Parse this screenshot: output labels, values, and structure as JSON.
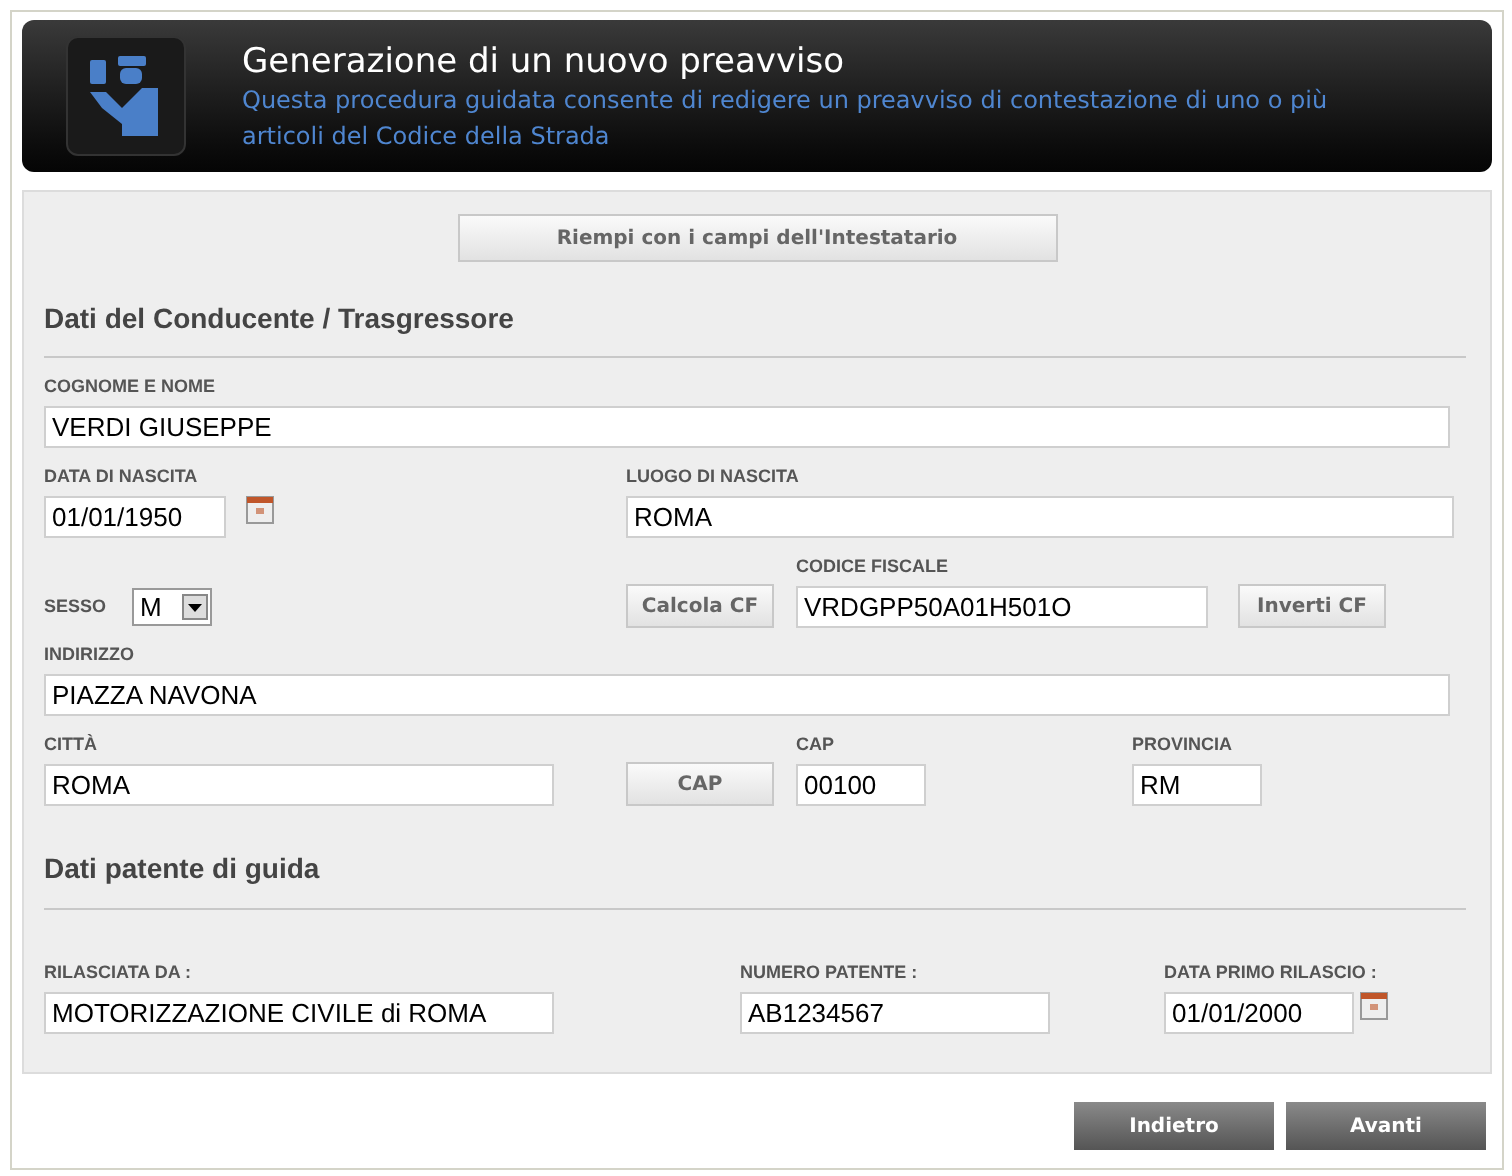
{
  "header": {
    "title": "Generazione di un nuovo preavviso",
    "description": "Questa procedura guidata consente di redigere un preavviso di contestazione di uno o più articoli del Codice della Strada"
  },
  "fill_button": "Riempi con i campi dell'Intestatario",
  "driver": {
    "heading": "Dati del Conducente / Trasgressore",
    "cognome_nome": {
      "label": "COGNOME E NOME",
      "value": "VERDI GIUSEPPE"
    },
    "data_nascita": {
      "label": "DATA DI NASCITA",
      "value": "01/01/1950"
    },
    "luogo_nascita": {
      "label": "LUOGO DI NASCITA",
      "value": "ROMA"
    },
    "sesso": {
      "label": "SESSO",
      "value": "M"
    },
    "calcola_button": "Calcola CF",
    "codice_fiscale": {
      "label": "CODICE FISCALE",
      "value": "VRDGPP50A01H501O"
    },
    "inverti_button": "Inverti CF",
    "indirizzo": {
      "label": "INDIRIZZO",
      "value": "PIAZZA NAVONA"
    },
    "citta": {
      "label": "CITTÀ",
      "value": "ROMA"
    },
    "cap_button": "CAP",
    "cap": {
      "label": "CAP",
      "value": "00100"
    },
    "provincia": {
      "label": "PROVINCIA",
      "value": "RM"
    }
  },
  "license": {
    "heading": "Dati patente di guida",
    "rilasciata_da": {
      "label": "RILASCIATA DA :",
      "value": "MOTORIZZAZIONE CIVILE di ROMA"
    },
    "numero_patente": {
      "label": "NUMERO PATENTE :",
      "value": "AB1234567"
    },
    "data_primo_rilascio": {
      "label": "DATA PRIMO RILASCIO :",
      "value": "01/01/2000"
    }
  },
  "buttons": [
    "Indietro",
    "Avanti"
  ]
}
